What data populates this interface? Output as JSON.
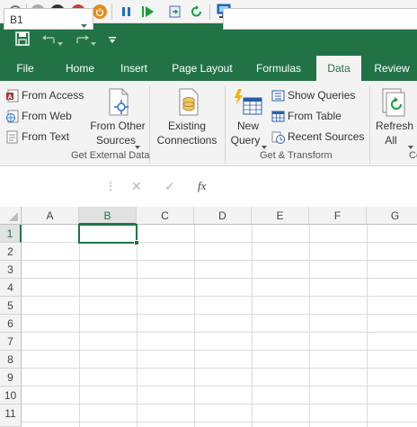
{
  "toolbar": {
    "icons": [
      "settings-icon",
      "stop-icon",
      "record-icon",
      "power-icon",
      "pause-icon",
      "play-icon",
      "export-icon",
      "refresh-icon",
      "network-icon"
    ]
  },
  "quick_access": {
    "save_tooltip": "Save",
    "undo_tooltip": "Undo",
    "redo_tooltip": "Redo",
    "customize_tooltip": "Customize Quick Access Toolbar"
  },
  "tabs": [
    {
      "label": "File"
    },
    {
      "label": "Home"
    },
    {
      "label": "Insert"
    },
    {
      "label": "Page Layout"
    },
    {
      "label": "Formulas"
    },
    {
      "label": "Data",
      "active": true
    },
    {
      "label": "Review"
    }
  ],
  "ribbon": {
    "get_external_data": {
      "group_label": "Get External Data",
      "from_access": "From Access",
      "from_web": "From Web",
      "from_text": "From Text",
      "from_other_sources_l1": "From Other",
      "from_other_sources_l2": "Sources",
      "existing_connections_l1": "Existing",
      "existing_connections_l2": "Connections"
    },
    "get_transform": {
      "group_label": "Get & Transform",
      "new_query_l1": "New",
      "new_query_l2": "Query",
      "show_queries": "Show Queries",
      "from_table": "From Table",
      "recent_sources": "Recent Sources"
    },
    "connections": {
      "refresh_all_l1": "Refresh",
      "refresh_all_l2": "All",
      "group_label_partial": "Co"
    }
  },
  "formula_bar": {
    "name_box": "B1",
    "fx_label": "fx",
    "cancel_symbol": "✕",
    "enter_symbol": "✓",
    "formula": ""
  },
  "grid": {
    "columns": [
      "A",
      "B",
      "C",
      "D",
      "E",
      "F",
      "G"
    ],
    "rows": [
      "1",
      "2",
      "3",
      "4",
      "5",
      "6",
      "7",
      "8",
      "9",
      "10",
      "11"
    ],
    "selected_cell": "B1"
  },
  "colors": {
    "accent": "#217346",
    "ribbon_bg": "#f3f3f3",
    "selection": "#217346"
  }
}
